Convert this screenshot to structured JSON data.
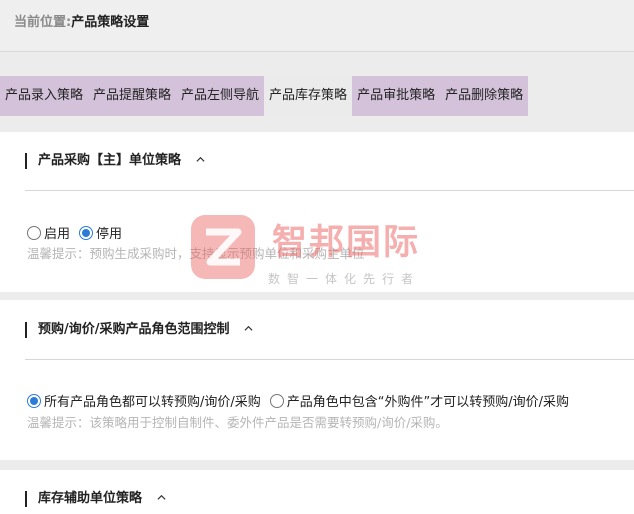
{
  "breadcrumb": {
    "prefix": "当前位置:",
    "current": "产品策略设置"
  },
  "tabs": [
    {
      "label": "产品录入策略",
      "active": false
    },
    {
      "label": "产品提醒策略",
      "active": false
    },
    {
      "label": "产品左侧导航",
      "active": false
    },
    {
      "label": "产品库存策略",
      "active": true
    },
    {
      "label": "产品审批策略",
      "active": false
    },
    {
      "label": "产品删除策略",
      "active": false
    }
  ],
  "sections": [
    {
      "title": "产品采购【主】单位策略",
      "icon": "chevron-up-icon",
      "options": [
        {
          "label": "启用",
          "checked": false
        },
        {
          "label": "停用",
          "checked": true
        }
      ],
      "hint": "温馨提示：预购生成采购时，支持显示预购单位和采购主单位"
    },
    {
      "title": "预购/询价/采购产品角色范围控制",
      "icon": "chevron-up-icon",
      "options": [
        {
          "label": "所有产品角色都可以转预购/询价/采购",
          "checked": true
        },
        {
          "label": "产品角色中包含“外购件”才可以转预购/询价/采购",
          "checked": false
        }
      ],
      "hint": "温馨提示：该策略用于控制自制件、委外件产品是否需要转预购/询价/采购。"
    },
    {
      "title": "库存辅助单位策略",
      "icon": "chevron-up-icon"
    }
  ],
  "watermark": {
    "logo": "智邦国际",
    "slogan": "数智一体化先行者",
    "color": "#eb5f5f"
  },
  "colors": {
    "tab_bg": "#d3c2da",
    "tab_active_bg": "#ecebec",
    "radio_checked": "#2b7cd6"
  }
}
